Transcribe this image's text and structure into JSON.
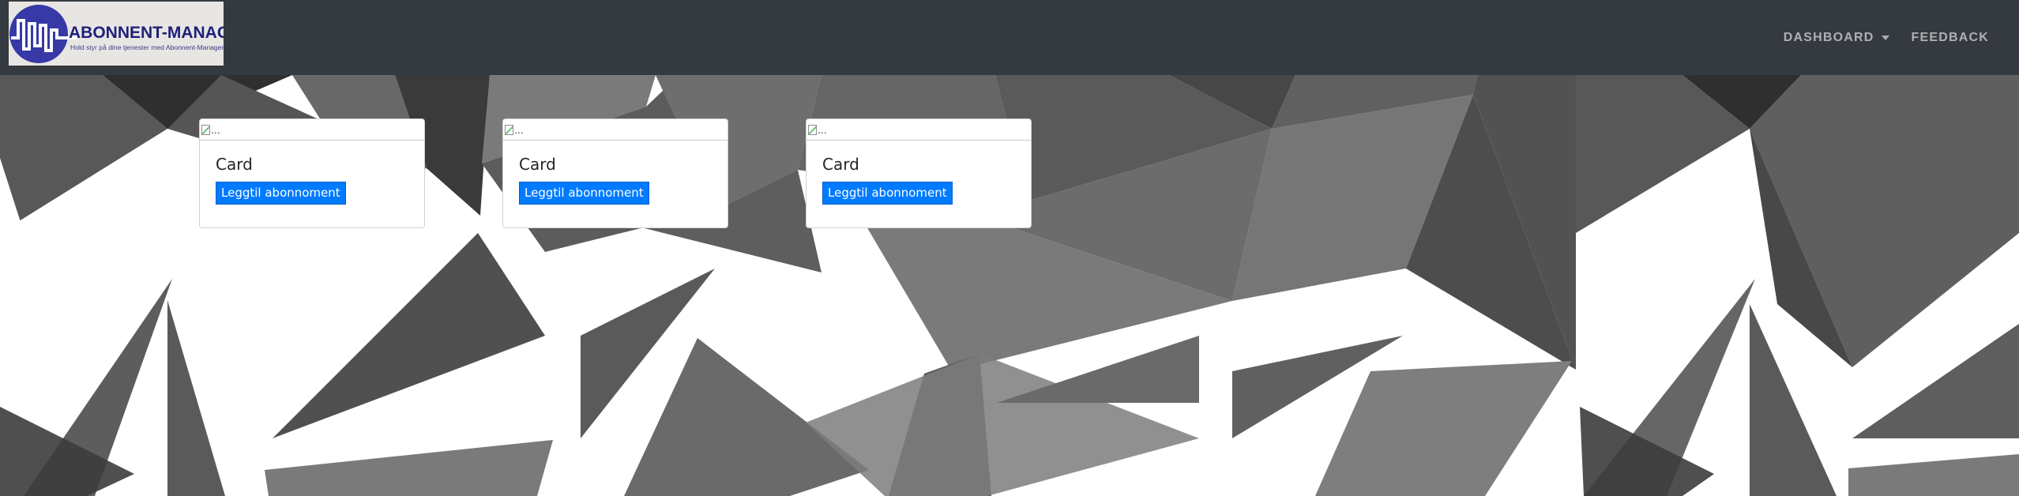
{
  "header": {
    "logo": {
      "brand_text": "ABONNENT-MANAGER",
      "tagline": "Hold styr på dine tjenester med Abonnent-Manager"
    },
    "nav": [
      {
        "label": "DASHBOARD",
        "has_dropdown": true
      },
      {
        "label": "FEEDBACK",
        "has_dropdown": false
      }
    ]
  },
  "colors": {
    "navbar": "#343a40",
    "button": "#007bff"
  },
  "cards": [
    {
      "image_alt": "...",
      "title": "Card",
      "button_label": "Leggtil abonnoment"
    },
    {
      "image_alt": "...",
      "title": "Card",
      "button_label": "Leggtil abonnoment"
    },
    {
      "image_alt": "...",
      "title": "Card",
      "button_label": "Leggtil abonnoment"
    }
  ]
}
